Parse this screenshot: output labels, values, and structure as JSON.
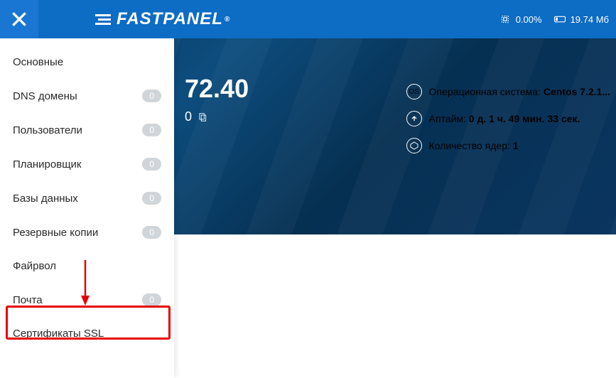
{
  "brand": "FASTPANEL",
  "top_stats": {
    "cpu_percent": "0.00%",
    "memory": "19.74 Мб"
  },
  "sidebar": {
    "items": [
      {
        "label": "Основные",
        "badge": null
      },
      {
        "label": "DNS домены",
        "badge": "0"
      },
      {
        "label": "Пользователи",
        "badge": "0"
      },
      {
        "label": "Планировщик",
        "badge": "0"
      },
      {
        "label": "Базы данных",
        "badge": "0"
      },
      {
        "label": "Резервные копии",
        "badge": "0"
      },
      {
        "label": "Файрвол",
        "badge": null
      },
      {
        "label": "Почта",
        "badge": "0"
      },
      {
        "label": "Сертификаты SSL",
        "badge": null
      }
    ]
  },
  "main": {
    "ip_partial": "72.40",
    "sub_partial": "0",
    "info": {
      "os_label": "Операционная система:",
      "os_value": "Centos 7.2.1...",
      "uptime_label": "Аптайм:",
      "uptime_value": "0 д. 1 ч. 49 мин. 33 сек.",
      "cores_label": "Количество ядер:",
      "cores_value": "1"
    }
  }
}
